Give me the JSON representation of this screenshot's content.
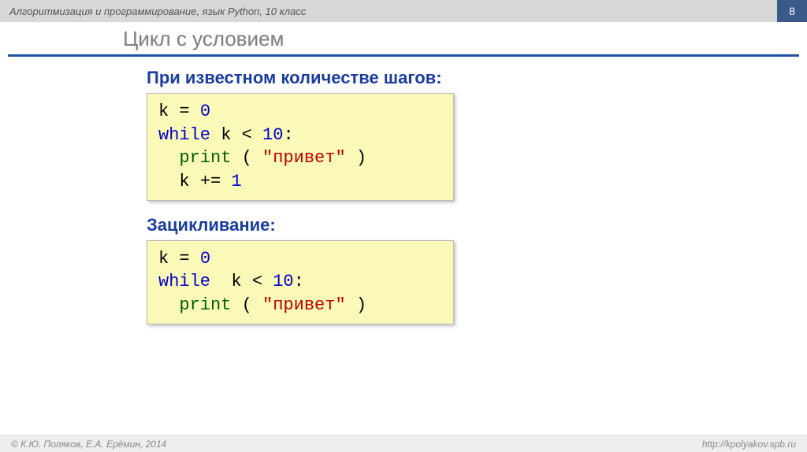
{
  "header": {
    "title": "Алгоритмизация и программирование, язык Python, 10 класс",
    "pageNumber": "8"
  },
  "slide": {
    "title": "Цикл с условием"
  },
  "section1": {
    "subtitle": "При известном количестве шагов:",
    "code": {
      "l1a": "k",
      "l1b": "=",
      "l1c": "0",
      "l2a": "while",
      "l2b": "k",
      "l2c": "<",
      "l2d": "10",
      "l2e": ":",
      "l3a": "print",
      "l3b": "(",
      "l3c": "\"привет\"",
      "l3d": ")",
      "l4a": "k",
      "l4b": "+=",
      "l4c": "1"
    }
  },
  "section2": {
    "subtitle": "Зацикливание:",
    "code": {
      "l1a": "k",
      "l1b": "=",
      "l1c": "0",
      "l2a": "while",
      "l2b": "k",
      "l2c": "<",
      "l2d": "10",
      "l2e": ":",
      "l3a": "print",
      "l3b": "(",
      "l3c": "\"привет\"",
      "l3d": ")"
    }
  },
  "footer": {
    "copyright": "© К.Ю. Поляков, Е.А. Ерёмин, 2014",
    "url": "http://kpolyakov.spb.ru"
  }
}
